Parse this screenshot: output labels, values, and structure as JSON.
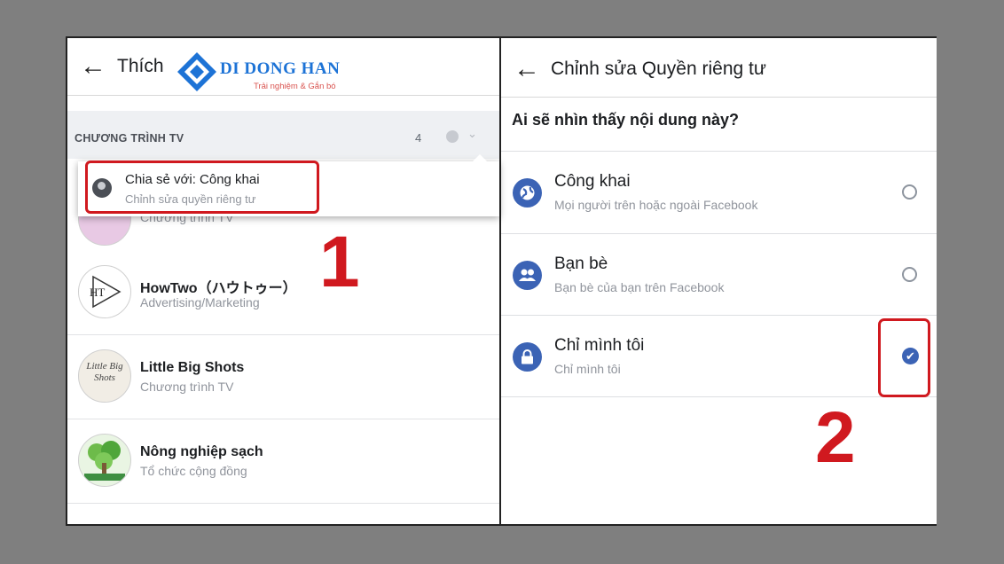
{
  "left": {
    "back_glyph": "←",
    "title": "Thích",
    "logo": {
      "name": "DI DONG HAN",
      "tagline": "Trải nghiệm & Gắn bó"
    },
    "section": {
      "title": "CHƯƠNG TRÌNH TV",
      "count": "4",
      "chevron": "⌄"
    },
    "popup": {
      "title": "Chia sẻ với: Công khai",
      "subtitle": "Chỉnh sửa quyền riêng tư"
    },
    "hidden_row_sub": "Chương trình TV",
    "rows": [
      {
        "title": "HowTwo（ハウトゥー）",
        "subtitle": "Advertising/Marketing",
        "avatar_text": "HT"
      },
      {
        "title": "Little Big Shots",
        "subtitle": "Chương trình TV",
        "avatar_text": "Little Big Shots"
      },
      {
        "title": "Nông nghiệp sạch",
        "subtitle": "Tổ chức cộng đồng",
        "avatar_text": ""
      }
    ],
    "annotation": "1"
  },
  "right": {
    "back_glyph": "←",
    "title": "Chỉnh sửa Quyền riêng tư",
    "question": "Ai sẽ nhìn thấy nội dung này?",
    "options": [
      {
        "title": "Công khai",
        "subtitle": "Mọi người trên hoặc ngoài Facebook",
        "icon": "globe-icon",
        "selected": false
      },
      {
        "title": "Bạn bè",
        "subtitle": "Bạn bè của bạn trên Facebook",
        "icon": "friends-icon",
        "selected": false
      },
      {
        "title": "Chỉ mình tôi",
        "subtitle": "Chỉ mình tôi",
        "icon": "lock-icon",
        "selected": true
      }
    ],
    "check_glyph": "✔",
    "annotation": "2"
  },
  "colors": {
    "accent": "#3b63b5",
    "annotation_red": "#d0191f",
    "background": "#7f7f7f"
  }
}
